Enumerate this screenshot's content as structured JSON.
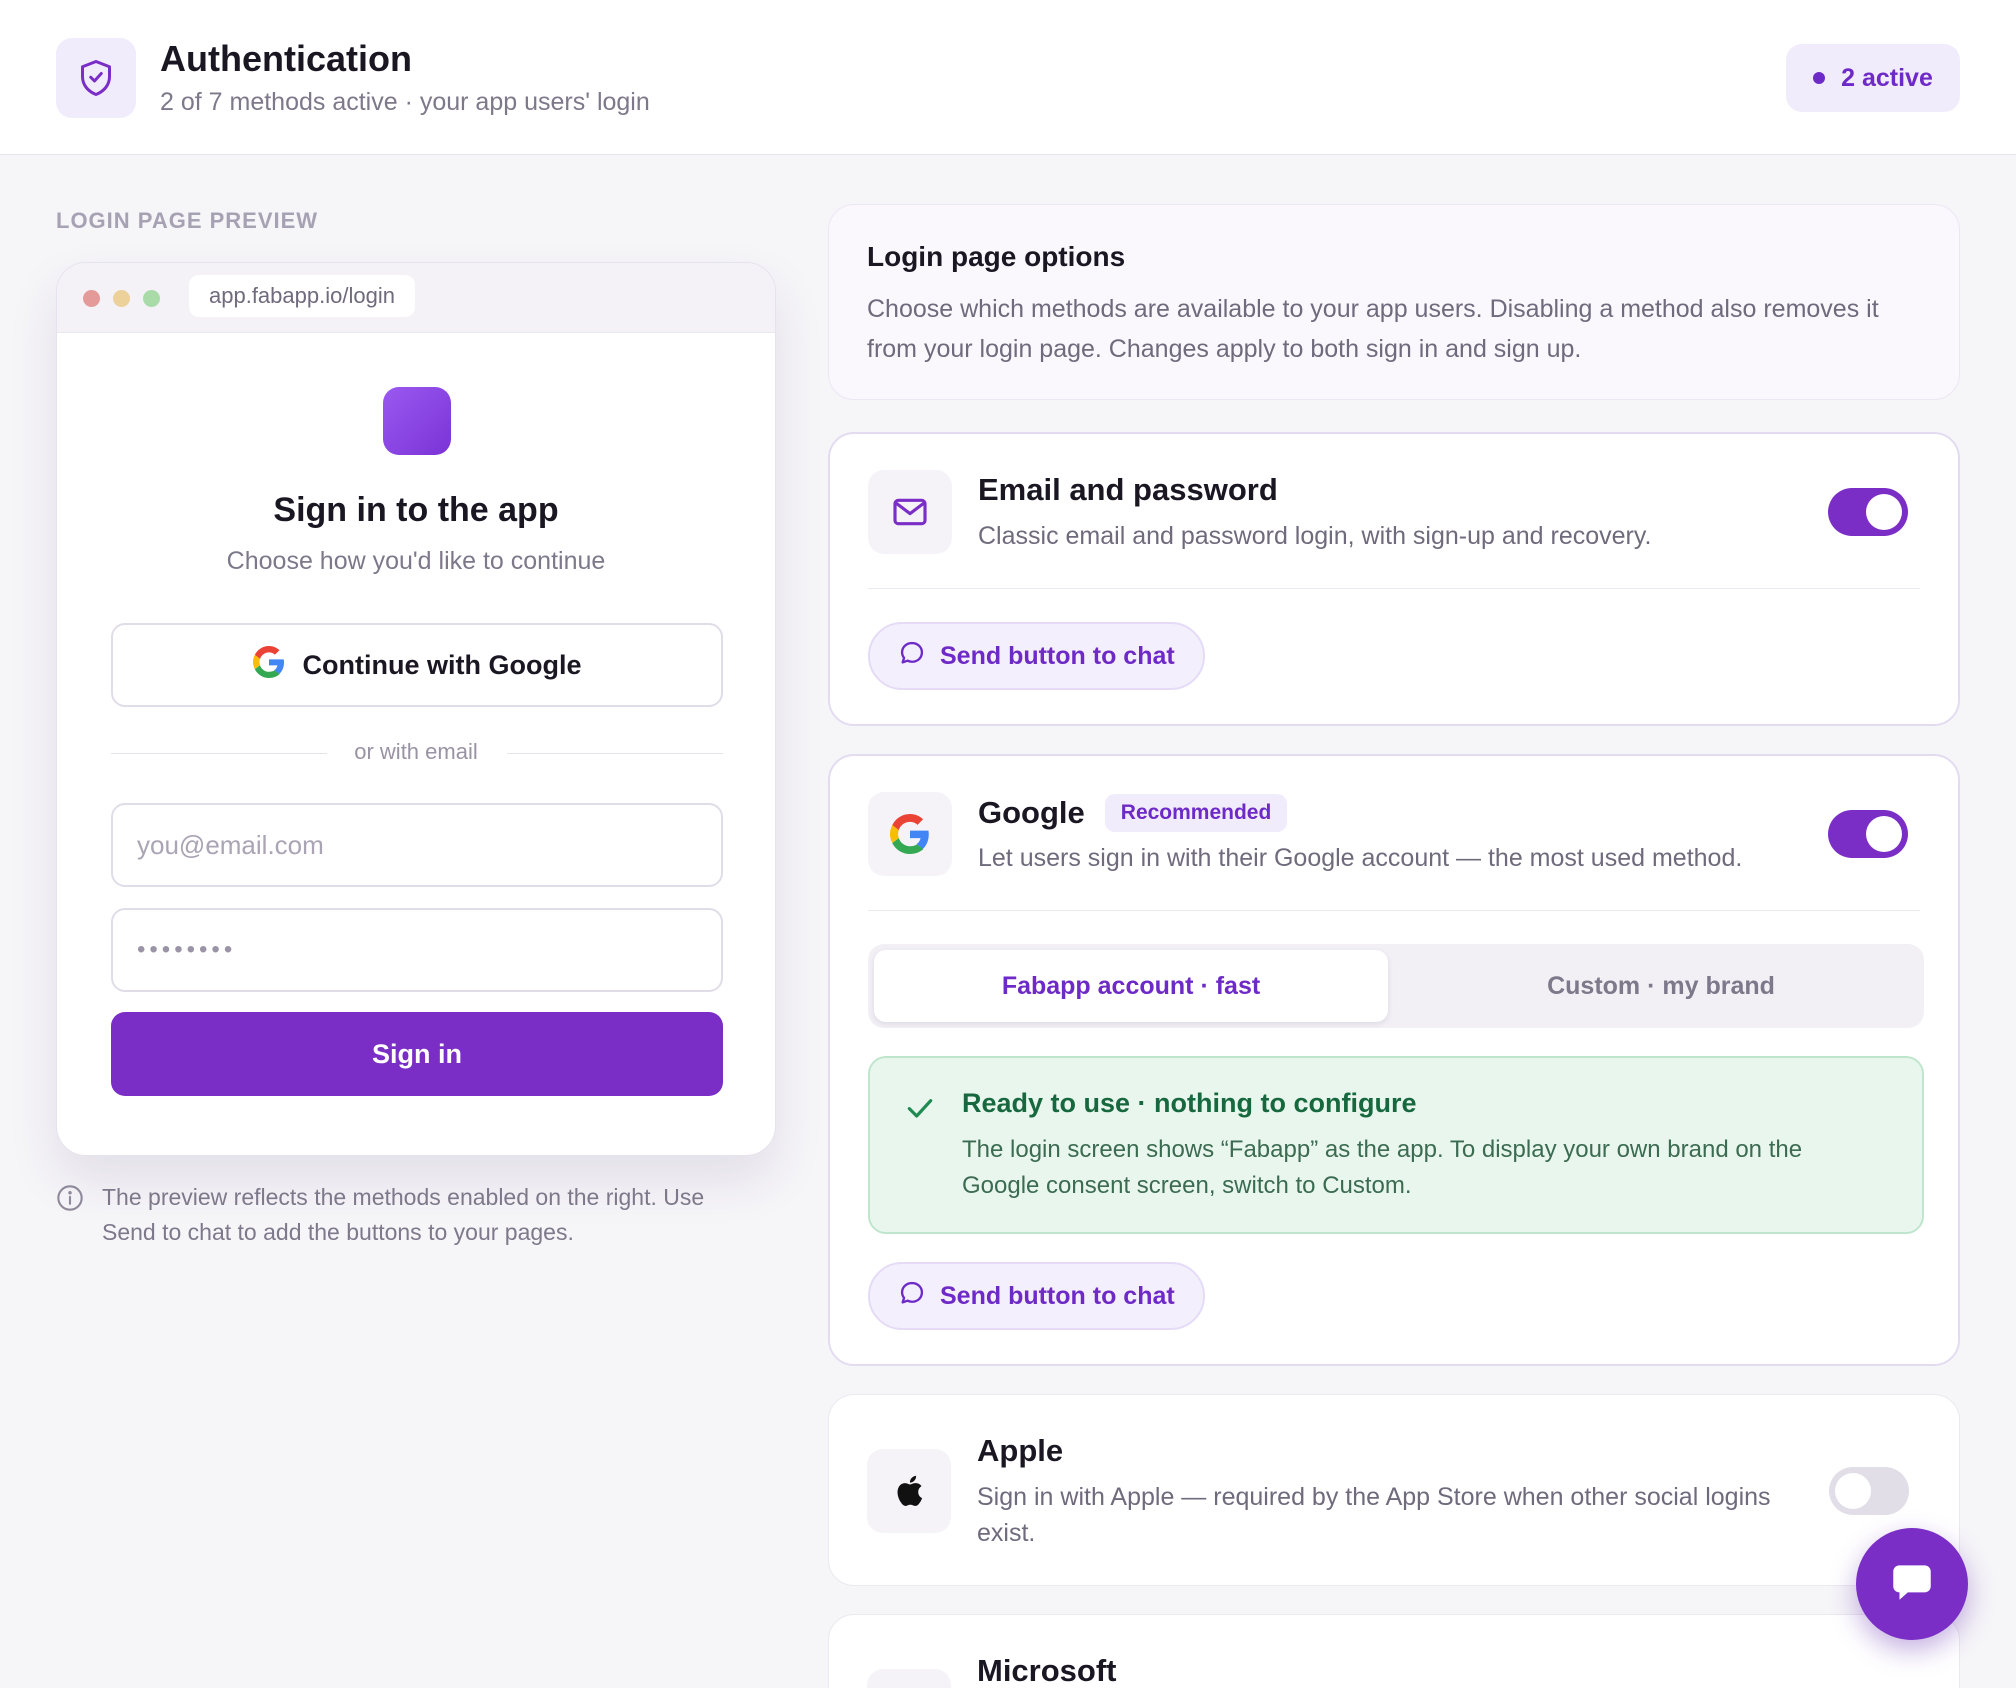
{
  "header": {
    "title": "Authentication",
    "subtitle": "2 of 7 methods active · your app users' login",
    "active_label": "2 active"
  },
  "preview": {
    "section_label": "LOGIN PAGE PREVIEW",
    "url": "app.fabapp.io/login",
    "title": "Sign in to the app",
    "subtitle": "Choose how you'd like to continue",
    "google_button": "Continue with Google",
    "divider_text": "or with email",
    "email_placeholder": "you@email.com",
    "password_value": "••••••••",
    "signin_button": "Sign in",
    "note": "The preview reflects the methods enabled on the right. Use Send to chat to add the buttons to your pages."
  },
  "options": {
    "title": "Login page options",
    "description": "Choose which methods are available to your app users. Disabling a method also removes it from your login page. Changes apply to both sign in and sign up."
  },
  "methods": [
    {
      "title": "Email and password",
      "description": "Classic email and password login, with sign-up and recovery.",
      "enabled": true,
      "icon": "mail-icon",
      "chat_button": "Send button to chat"
    },
    {
      "title": "Google",
      "badge": "Recommended",
      "description": "Let users sign in with their Google account — the most used method.",
      "enabled": true,
      "icon": "google-icon",
      "segments": [
        "Fabapp account · fast",
        "Custom · my brand"
      ],
      "selected_segment": 0,
      "ready_title": "Ready to use · nothing to configure",
      "ready_description": "The login screen shows “Fabapp” as the app. To display your own brand on the Google consent screen, switch to Custom.",
      "chat_button": "Send button to chat"
    },
    {
      "title": "Apple",
      "description": "Sign in with Apple — required by the App Store when other social logins exist.",
      "enabled": false,
      "icon": "apple-icon"
    },
    {
      "title": "Microsoft",
      "icon": "microsoft-icon"
    }
  ],
  "colors": {
    "accent": "#7a2ec6",
    "success_bg": "#e9f6ee",
    "success_text": "#17683e"
  }
}
